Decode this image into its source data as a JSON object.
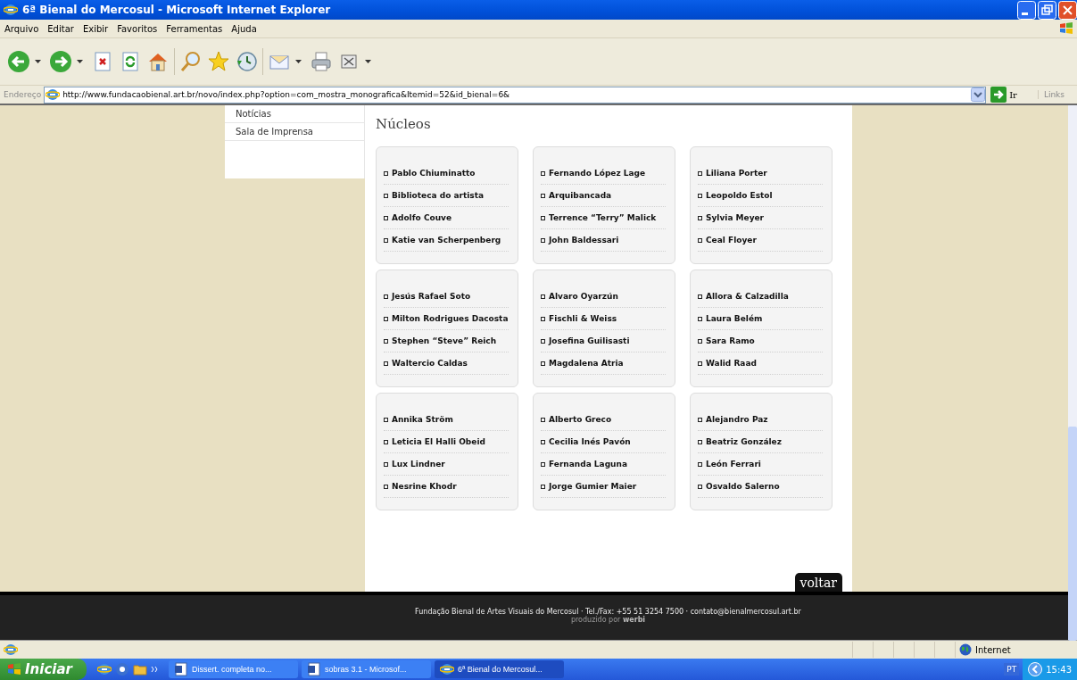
{
  "window": {
    "title": "6ª Bienal do Mercosul - Microsoft Internet Explorer"
  },
  "menu": [
    "Arquivo",
    "Editar",
    "Exibir",
    "Favoritos",
    "Ferramentas",
    "Ajuda"
  ],
  "address_bar": {
    "label": "Endereço",
    "value": "http://www.fundacaobienal.art.br/novo/index.php?option=com_mostra_monografica&Itemid=52&id_bienal=6&",
    "go": "Ir",
    "links": "Links"
  },
  "sidebar": {
    "items": [
      "Notícias",
      "Sala de Imprensa"
    ]
  },
  "heading": "Núcleos",
  "groups": [
    {
      "items": [
        "Pablo Chiuminatto",
        "Biblioteca do artista",
        "Adolfo Couve",
        "Katie van Scherpenberg"
      ]
    },
    {
      "items": [
        "Fernando López Lage",
        "Arquibancada",
        "Terrence “Terry” Malick",
        "John Baldessari"
      ]
    },
    {
      "items": [
        "Liliana Porter",
        "Leopoldo Estol",
        "Sylvia Meyer",
        "Ceal Floyer"
      ]
    },
    {
      "items": [
        "Jesús Rafael Soto",
        "Milton Rodrigues Dacosta",
        "Stephen “Steve” Reich",
        "Waltercio Caldas"
      ]
    },
    {
      "items": [
        "Alvaro Oyarzún",
        "Fischli & Weiss",
        "Josefina Guilisasti",
        "Magdalena Atria"
      ]
    },
    {
      "items": [
        "Allora & Calzadilla",
        "Laura Belém",
        "Sara Ramo",
        "Walid Raad"
      ]
    },
    {
      "items": [
        "Annika Ström",
        "Leticia El Halli Obeid",
        "Lux Lindner",
        "Nesrine Khodr"
      ]
    },
    {
      "items": [
        "Alberto Greco",
        "Cecilia Inés Pavón",
        "Fernanda Laguna",
        "Jorge Gumier Maier"
      ]
    },
    {
      "items": [
        "Alejandro Paz",
        "Beatriz González",
        "León Ferrari",
        "Osvaldo Salerno"
      ]
    }
  ],
  "back_button": "voltar",
  "footer": {
    "contact": "Fundação Bienal de Artes Visuais do Mercosul · Tel./Fax: +55 51 3254 7500 · contato@bienalmercosul.art.br",
    "credit": "produzido por **werbi**"
  },
  "status_bar": {
    "zone": "Internet"
  },
  "taskbar": {
    "start": "Iniciar",
    "tasks": [
      {
        "label": "Dissert. completa  no...",
        "selected": false,
        "kind": "word"
      },
      {
        "label": "sobras 3.1 - Microsof...",
        "selected": false,
        "kind": "word"
      },
      {
        "label": "6ª Bienal do Mercosul...",
        "selected": true,
        "kind": "browser"
      }
    ],
    "language": "PT",
    "clock": "15:43"
  }
}
